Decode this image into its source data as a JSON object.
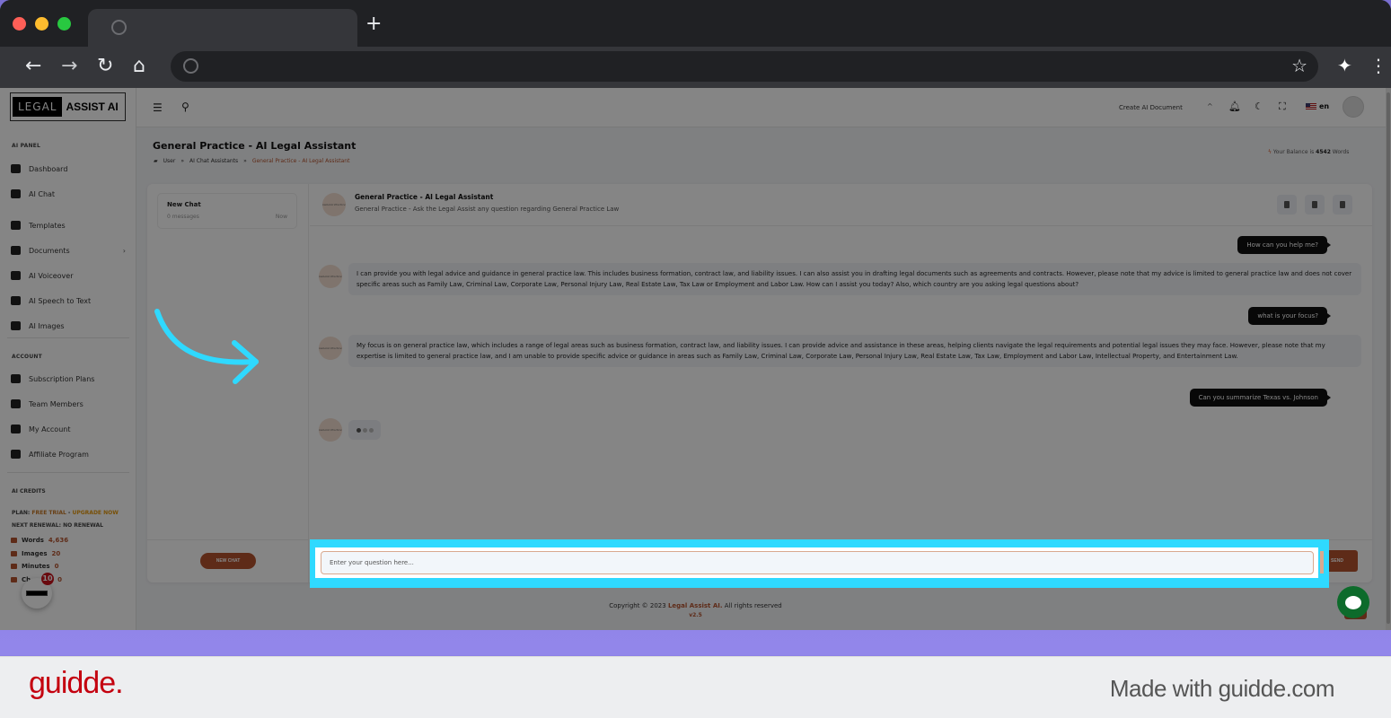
{
  "browser": {
    "tab_title": "",
    "new_tab_label": "+",
    "address": ""
  },
  "app": {
    "logo_left": "LEGAL",
    "logo_right": "ASSIST AI"
  },
  "sidebar": {
    "sections": [
      {
        "title": "AI PANEL",
        "items": [
          {
            "label": "Dashboard",
            "icon": "dashboard-icon"
          },
          {
            "label": "AI Chat",
            "icon": "chat-icon"
          },
          {
            "label": "Templates",
            "icon": "chip-icon"
          },
          {
            "label": "Documents",
            "icon": "folder-icon",
            "has_submenu": true
          },
          {
            "label": "AI Voiceover",
            "icon": "waveform-icon"
          },
          {
            "label": "AI Speech to Text",
            "icon": "music-file-icon"
          },
          {
            "label": "AI Images",
            "icon": "camera-icon"
          }
        ]
      },
      {
        "title": "ACCOUNT",
        "items": [
          {
            "label": "Subscription Plans",
            "icon": "subscription-icon"
          },
          {
            "label": "Team Members",
            "icon": "team-icon"
          },
          {
            "label": "My Account",
            "icon": "id-card-icon"
          },
          {
            "label": "Affiliate Program",
            "icon": "dollar-badge-icon"
          }
        ]
      }
    ],
    "credits": {
      "title": "AI CREDITS",
      "plan_label": "PLAN:",
      "plan_value": "FREE TRIAL",
      "plan_sep": " - ",
      "upgrade_label": "UPGRADE NOW",
      "renewal_label": "NEXT RENEWAL: NO RENEWAL",
      "rows": [
        {
          "label": "Words",
          "value": "4,636"
        },
        {
          "label": "Images",
          "value": "20"
        },
        {
          "label": "Minutes",
          "value": "0"
        },
        {
          "label": "Ch",
          "value": "0"
        }
      ]
    },
    "notification_badge": "10"
  },
  "topbar": {
    "create_document": "Create AI Document",
    "language": "en"
  },
  "page": {
    "title": "General Practice - AI Legal Assistant",
    "breadcrumb": [
      "User",
      "AI Chat Assistants",
      "General Practice - AI Legal Assistant"
    ],
    "breadcrumb_sep": "»",
    "balance_prefix": "Your Balance is",
    "balance_value": "4542",
    "balance_suffix": "Words"
  },
  "conversations": {
    "items": [
      {
        "title": "New Chat",
        "count": "0 messages",
        "time": "Now"
      }
    ],
    "new_chat_button": "NEW CHAT"
  },
  "chat": {
    "bot_name": "General Practice - AI Legal Assistant",
    "bot_description": "General Practice - Ask the Legal Assist any question regarding General Practice Law",
    "avatar_text": "General Practice",
    "messages": [
      {
        "role": "user",
        "text": "How can you help me?"
      },
      {
        "role": "bot",
        "text": "I can provide you with legal advice and guidance in general practice law. This includes business formation, contract law, and liability issues. I can also assist you in drafting legal documents such as agreements and contracts. However, please note that my advice is limited to general practice law and does not cover specific areas such as Family Law, Criminal Law, Corporate Law, Personal Injury Law, Real Estate Law, Tax Law or Employment and Labor Law. How can I assist you today? Also, which country are you asking legal questions about?"
      },
      {
        "role": "user",
        "text": "what is your focus?"
      },
      {
        "role": "bot",
        "text": "My focus is on general practice law, which includes a range of legal areas such as business formation, contract law, and liability issues. I can provide advice and assistance in these areas, helping clients navigate the legal requirements and potential legal issues they may face. However, please note that my expertise is limited to general practice law, and I am unable to provide specific advice or guidance in areas such as Family Law, Criminal Law, Corporate Law, Personal Injury Law, Real Estate Law, Tax Law, Employment and Labor Law, Intellectual Property, and Entertainment Law."
      },
      {
        "role": "user",
        "text": "Can you summarize Texas vs. Johnson"
      }
    ],
    "input_placeholder": "Enter your question here...",
    "input_value": "",
    "send_button": "SEND"
  },
  "footer": {
    "copyright_prefix": "Copyright © 2023",
    "brand": "Legal Assist AI.",
    "copyright_suffix": "All rights reserved",
    "version": "v2.5"
  },
  "guidde": {
    "logo": "guidde.",
    "made_with": "Made with guidde.com"
  },
  "colors": {
    "accent": "#b5542f",
    "highlight": "#2fd9ff",
    "guidde_red": "#c4000f"
  }
}
